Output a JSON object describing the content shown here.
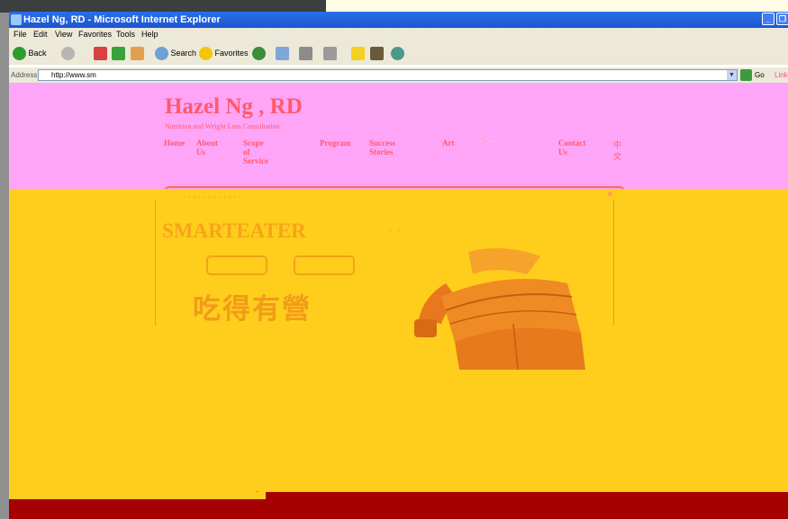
{
  "window": {
    "title": "Hazel Ng, RD - Microsoft Internet Explorer",
    "controls": [
      "_",
      "❐"
    ]
  },
  "menu": [
    "File",
    "Edit",
    "View",
    "Favorites",
    "Tools",
    "Help"
  ],
  "toolbar": {
    "back": "Back",
    "search": "Search",
    "favorites": "Favorites"
  },
  "address": {
    "label": "Address",
    "url": "http://www.sm",
    "go": "Go",
    "links": "Link"
  },
  "site": {
    "title": "Hazel Ng , RD",
    "subtitle": "Nutrition and Weight Loss Consultation",
    "nav": [
      "Home",
      "About Us",
      "Scope of Service",
      "Program",
      "Success Stories",
      "Art",
      "Contact Us",
      "中文"
    ]
  },
  "banner": {
    "name": "SMARTEATER",
    "chinese": "吃得有營",
    "close": "×"
  },
  "colors": {
    "pink_band": "#ffa5f7",
    "yellow_main": "#ffcd1c",
    "bottom_band": "#a70000",
    "title_accent": "#ff5a6a"
  }
}
